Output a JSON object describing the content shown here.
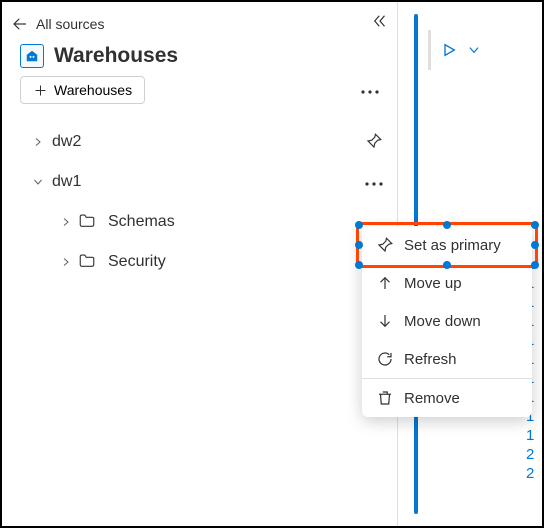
{
  "topbar": {
    "label": "All sources"
  },
  "section": {
    "title": "Warehouses",
    "add_label": "Warehouses"
  },
  "tree": {
    "dw2_label": "dw2",
    "dw1_label": "dw1",
    "schemas_label": "Schemas",
    "security_label": "Security"
  },
  "menu": {
    "set_primary": "Set as primary",
    "move_up": "Move up",
    "move_down": "Move down",
    "refresh": "Refresh",
    "remove": "Remove"
  },
  "numbers": [
    "1",
    "1",
    "1",
    "1",
    "1",
    "1",
    "1",
    "1",
    "1",
    "1",
    "2",
    "2"
  ]
}
